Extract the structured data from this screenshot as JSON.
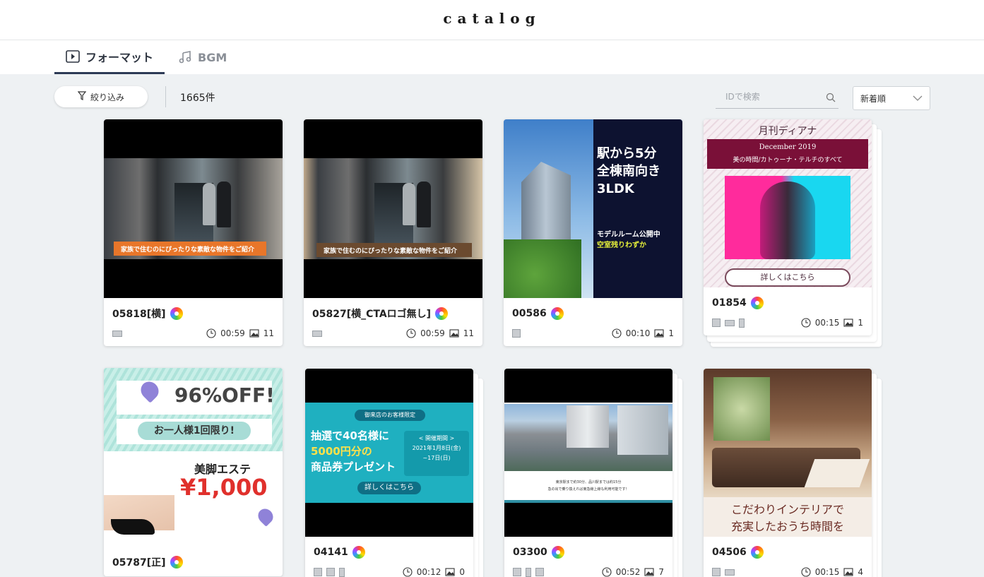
{
  "app": {
    "logo": "catalog"
  },
  "tabs": [
    {
      "label": "フォーマット",
      "icon": "play-icon",
      "active": true
    },
    {
      "label": "BGM",
      "icon": "music-note-icon",
      "active": false
    }
  ],
  "toolbar": {
    "filter_label": "絞り込み",
    "count": "1665件",
    "search_placeholder": "IDで検索",
    "sort_value": "新着順"
  },
  "cards": [
    {
      "id": "05818[横]",
      "duration": "00:59",
      "images": "11",
      "formats": [
        "wide"
      ],
      "stacked": false,
      "thumb_text": "家族で住むのにぴったりな素敵な物件をご紹介"
    },
    {
      "id": "05827[横_CTAロゴ無し]",
      "duration": "00:59",
      "images": "11",
      "formats": [
        "wide"
      ],
      "stacked": false,
      "thumb_text": "家族で住むのにぴったりな素敵な物件をご紹介"
    },
    {
      "id": "00586",
      "duration": "00:10",
      "images": "1",
      "formats": [
        "sq"
      ],
      "stacked": false,
      "thumb_lines": [
        "駅から5分",
        "全棟南向き",
        "3LDK",
        "モデルルーム公開中",
        "空室残りわずか"
      ]
    },
    {
      "id": "01854",
      "duration": "00:15",
      "images": "1",
      "formats": [
        "sq",
        "wide",
        "tall"
      ],
      "stacked": true,
      "thumb_lines": [
        "月刊ディアナ",
        "December 2019",
        "美の時間/カトゥーナ・テルチのすべて",
        "詳しくはこちら"
      ]
    },
    {
      "id": "05787[正]",
      "duration": "",
      "images": "",
      "formats": [],
      "stacked": false,
      "thumb_lines": [
        "96%OFF!",
        "お一人様1回限り!",
        "美脚エステ",
        "¥1,000"
      ]
    },
    {
      "id": "04141",
      "duration": "00:12",
      "images": "0",
      "formats": [
        "sq",
        "sq",
        "tall"
      ],
      "stacked": true,
      "thumb_lines": [
        "御来店のお客様限定",
        "抽選で40名様に",
        "5000円分の",
        "商品券プレゼント",
        "< 開催期間 >",
        "2021年1月8日(金)",
        "~17日(日)",
        "詳しくはこちら"
      ]
    },
    {
      "id": "03300",
      "duration": "00:52",
      "images": "7",
      "formats": [
        "sq",
        "tall",
        "sq"
      ],
      "stacked": true,
      "thumb_lines": [
        "東京駅まで約30分、品川駅までは約15分",
        "急の出で乗り換えれば東急線上線も利用可能です！"
      ]
    },
    {
      "id": "04506",
      "duration": "00:15",
      "images": "4",
      "formats": [
        "sq",
        "wide"
      ],
      "stacked": true,
      "thumb_lines": [
        "こだわりインテリアで",
        "充実したおうち時間を"
      ]
    }
  ]
}
